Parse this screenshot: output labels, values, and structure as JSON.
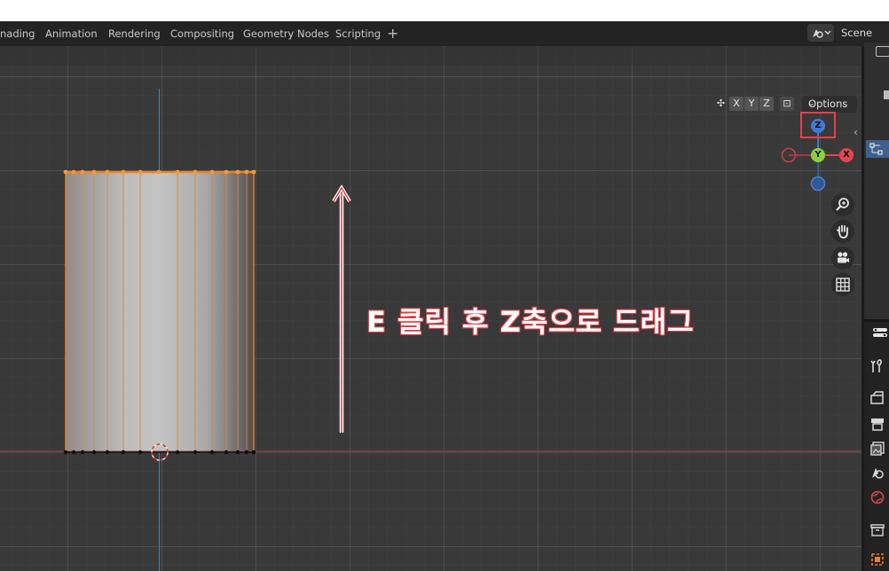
{
  "workspace_tabs": [
    {
      "label": "nading"
    },
    {
      "label": "Animation"
    },
    {
      "label": "Rendering"
    },
    {
      "label": "Compositing"
    },
    {
      "label": "Geometry Nodes"
    },
    {
      "label": "Scripting"
    }
  ],
  "add_workspace": "+",
  "scene": {
    "name": "Scene"
  },
  "viewport": {
    "axis_buttons": [
      "X",
      "Y",
      "Z"
    ],
    "options_label": "Options",
    "gizmo": {
      "z": "Z",
      "y": "Y",
      "x": "X"
    },
    "annotation": "E 클릭 후 Z축으로 드래그"
  },
  "colors": {
    "selected_edge": "#e8832a",
    "annotation_outline": "#e0404a",
    "gizmo_x": "#e5454f",
    "gizmo_y": "#8bd13b",
    "gizmo_z": "#3f7bd4",
    "gizmo_neg_x": "#a33a41",
    "gizmo_neg_z": "#305b98",
    "outliner_selection": "#3f5f8d"
  },
  "icons": {
    "scene_selector": "scene-icon",
    "nav": [
      "zoom-icon",
      "hand-icon",
      "camera-icon",
      "grid-icon"
    ],
    "properties": [
      "tool-icon",
      "render-icon",
      "output-icon",
      "view-layer-icon",
      "scene-icon",
      "world-icon",
      "collection-icon",
      "object-icon"
    ]
  }
}
